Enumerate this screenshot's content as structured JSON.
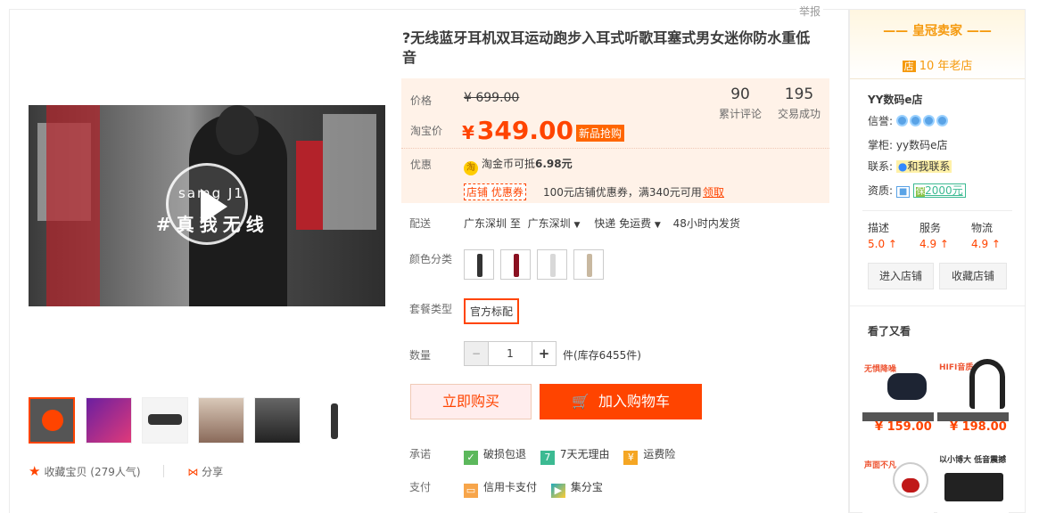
{
  "report": "举报",
  "product": {
    "title": "?无线蓝牙耳机双耳运动跑步入耳式听歌耳塞式男女迷你防水重低音",
    "video_brand": "samg J1",
    "video_slogan": "#真我无线"
  },
  "price": {
    "label": "价格",
    "original": "¥ 699.00",
    "taobao_label": "淘宝价",
    "currency": "¥",
    "current": "349.00",
    "new_tag": "新品抢购",
    "reviews_count": "90",
    "reviews_label": "累计评论",
    "sales_count": "195",
    "sales_label": "交易成功"
  },
  "promo": {
    "label": "优惠",
    "coin_text": "淘金币可抵",
    "coin_value": "6.98元",
    "shop_coupon": "店铺 优惠券",
    "coupon_desc": "100元店铺优惠券，满340元可用",
    "claim": "领取"
  },
  "shipping": {
    "label": "配送",
    "from": "广东深圳 至",
    "to": "广东深圳",
    "method": "快递 免运费",
    "dispatch": "48小时内发货"
  },
  "color": {
    "label": "颜色分类",
    "swatches": [
      "#333333",
      "#8a1020",
      "#d8d8d8",
      "#c8b8a0"
    ]
  },
  "package": {
    "label": "套餐类型",
    "option": "官方标配"
  },
  "quantity": {
    "label": "数量",
    "minus": "−",
    "value": "1",
    "plus": "+",
    "stock": "件(库存6455件)"
  },
  "buttons": {
    "buy": "立即购买",
    "cart": "加入购物车"
  },
  "promise": {
    "label": "承诺",
    "items": [
      "破损包退",
      "7天无理由",
      "运费险"
    ]
  },
  "payment": {
    "label": "支付",
    "items": [
      "信用卡支付",
      "集分宝"
    ]
  },
  "favorites": {
    "label": "收藏宝贝",
    "count": "(279人气)",
    "share": "分享"
  },
  "seller": {
    "crown": "皇冠卖家",
    "years_icon": "店",
    "years": "10 年老店",
    "shop_name": "YY数码e店",
    "credit_label": "信誉:",
    "owner_label": "掌柜:",
    "owner": "yy数码e店",
    "contact_label": "联系:",
    "contact": "和我联系",
    "qual_label": "资质:",
    "deposit": "2000元",
    "ratings": [
      {
        "label": "描述",
        "score": "5.0"
      },
      {
        "label": "服务",
        "score": "4.9"
      },
      {
        "label": "物流",
        "score": "4.9"
      }
    ],
    "enter_shop": "进入店铺",
    "fav_shop": "收藏店铺"
  },
  "recommend": {
    "title": "看了又看",
    "items": [
      {
        "price": "¥ 159.00",
        "tag": "无惧降噪"
      },
      {
        "price": "¥ 198.00",
        "tag": "HIFI音质"
      },
      {
        "tag": "声面不凡"
      },
      {
        "tag": "以小博大 低音震撼"
      }
    ]
  }
}
